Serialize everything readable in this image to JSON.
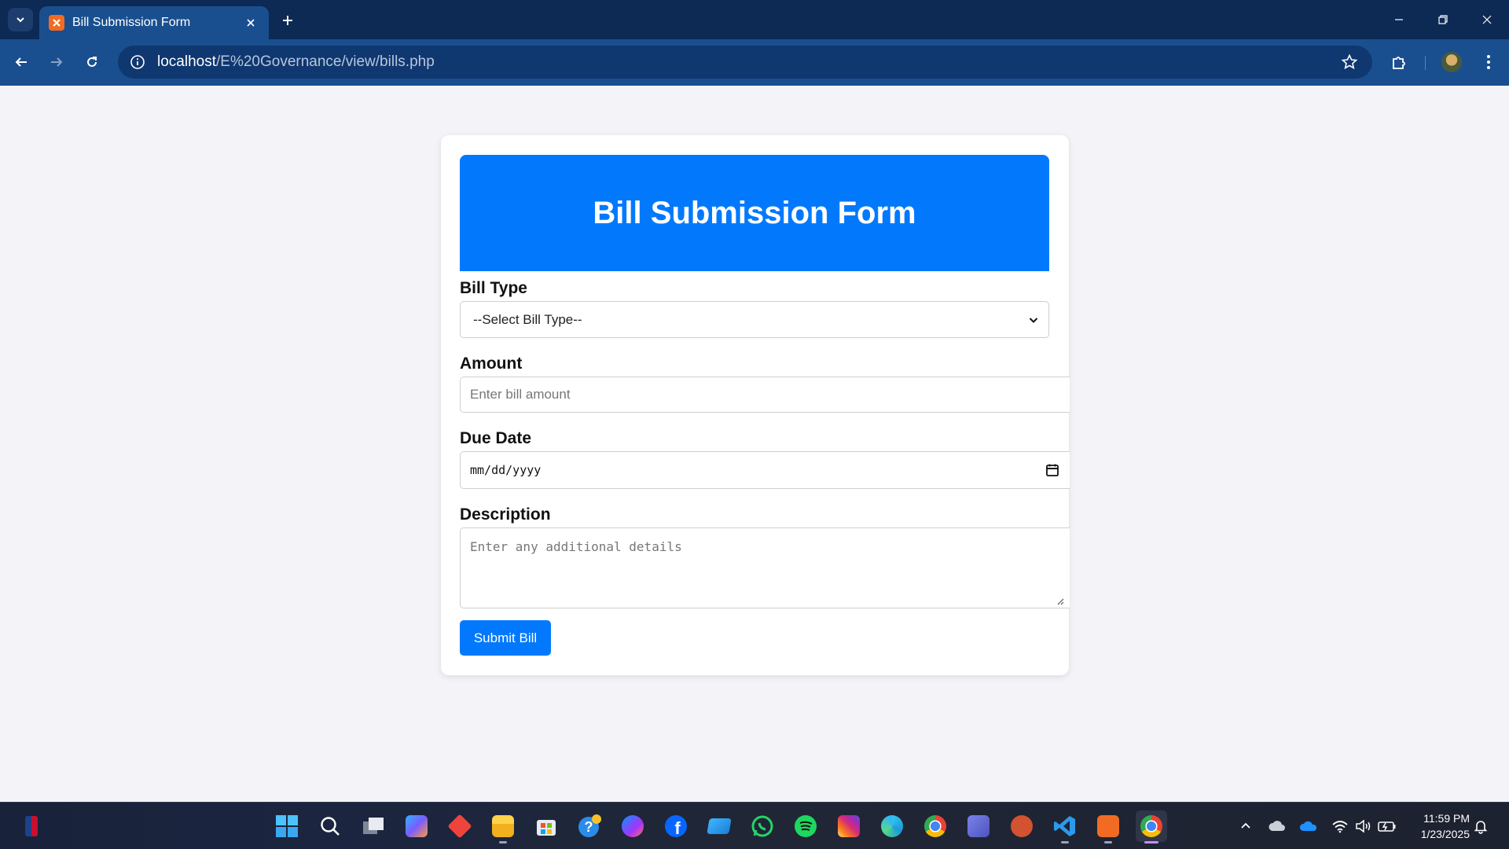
{
  "browser": {
    "tab_title": "Bill Submission Form",
    "url_host": "localhost",
    "url_path": "/E%20Governance/view/bills.php"
  },
  "form": {
    "title": "Bill Submission Form",
    "bill_type_label": "Bill Type",
    "bill_type_selected": "--Select Bill Type--",
    "amount_label": "Amount",
    "amount_placeholder": "Enter bill amount",
    "due_date_label": "Due Date",
    "due_date_value": "mm/dd/yyyy",
    "description_label": "Description",
    "description_placeholder": "Enter any additional details",
    "submit_label": "Submit Bill"
  },
  "colors": {
    "accent": "#0279fd",
    "chrome_tabstrip": "#0d2a55",
    "chrome_toolbar": "#1a4f8f",
    "page_bg": "#f4f4f8"
  },
  "taskbar": {
    "apps": [
      "nba-icon",
      "start-icon",
      "search-icon",
      "task-view-icon",
      "copilot-icon",
      "anydesk-icon",
      "file-explorer-icon",
      "store-icon",
      "help-icon",
      "messenger-icon",
      "facebook-icon",
      "app-icon",
      "whatsapp-icon",
      "spotify-icon",
      "instagram-icon",
      "edge-icon",
      "chrome-icon",
      "teams-icon",
      "powerpoint-icon",
      "vscode-icon",
      "xampp-icon",
      "chrome-active-icon"
    ],
    "time": "11:59 PM",
    "date": "1/23/2025"
  }
}
